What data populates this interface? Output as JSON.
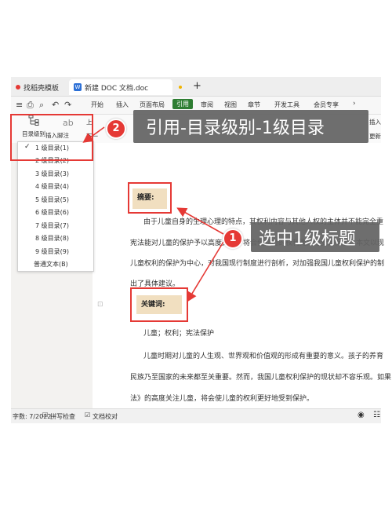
{
  "tabs": [
    {
      "label": "找稻壳模板",
      "icon": "docer-icon"
    },
    {
      "label": "新建 DOC 文档.doc",
      "icon": "wps-writer-icon"
    }
  ],
  "new_tab_symbol": "+",
  "menu": {
    "items": [
      "开始",
      "插入",
      "页面布局",
      "引用",
      "审阅",
      "视图",
      "章节",
      "开发工具",
      "会员专享"
    ],
    "active": "引用"
  },
  "ribbon": {
    "outline_level_label": "目录级别",
    "insert_footnote_label": "插入脚注",
    "next_footnote_label": "下一",
    "cross_ref_fragment_1": "ab",
    "cross_ref_fragment_2": "上",
    "ribbon_right_1": "插入",
    "ribbon_right_2": "更新"
  },
  "outline_dropdown": {
    "items": [
      "1 级目录(1)",
      "2 级目录(2)",
      "3 级目录(3)",
      "4 级目录(4)",
      "5 级目录(5)",
      "6 级目录(6)",
      "7 级目录(7)",
      "8 级目录(8)",
      "9 级目录(9)",
      "普通文本(B)"
    ],
    "selected_index": 0
  },
  "callouts": {
    "step2_number": "2",
    "step2_text": "引用-目录级别-1级目录",
    "step1_number": "1",
    "step1_text": "选中1级标题"
  },
  "document": {
    "abstract_heading": "摘要:",
    "abstract_lines": [
      "由于儿童自身的生理心理的特点，其权利内容与其他人权的主体并不能完全重",
      "宪法能对儿童的保护予以高度关注，将会使儿童的权利更好地受到保护。本文以现",
      "儿童权利的保护为中心，对我国现行制度进行剖析，对加强我国儿童权利保护的制",
      "出了具体建议。"
    ],
    "keywords_heading": "关键词:",
    "keywords_line": "儿童；权利；宪法保护",
    "body_lines": [
      "儿童时期对儿童的人生观、世界观和价值观的形成有重要的意义。孩子的养育",
      "民族乃至国家的未来都至关重要。然而，我国儿童权利保护的现状却不容乐观。如果",
      "法》的高度关注儿童，将会使儿童的权利更好地受到保护。"
    ]
  },
  "statusbar": {
    "page_info": "字数: 7/2022",
    "spell_check": "拼写检查",
    "proofread": "文档校对"
  },
  "colors": {
    "highlight_red": "#e53935",
    "active_menu_green": "#2e7d32",
    "heading_highlight": "#f1dfc0",
    "callout_bg": "#636363"
  }
}
